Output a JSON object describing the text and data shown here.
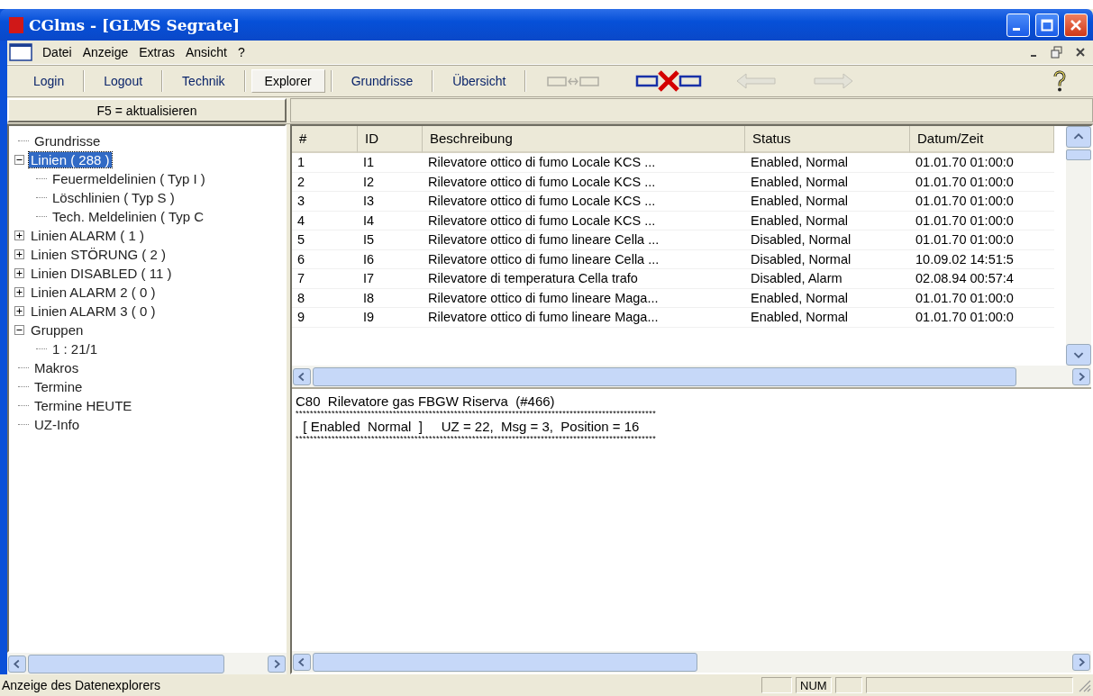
{
  "window": {
    "title": "CGlms - [GLMS Segrate]"
  },
  "menu": [
    "Datei",
    "Anzeige",
    "Extras",
    "Ansicht",
    "?"
  ],
  "toolbar": {
    "buttons": [
      {
        "label": "Login",
        "selected": false
      },
      {
        "label": "Logout",
        "selected": false
      },
      {
        "label": "Technik",
        "selected": false
      },
      {
        "label": "Explorer",
        "selected": true
      },
      {
        "label": "Grundrisse",
        "selected": false
      },
      {
        "label": "Übersicht",
        "selected": false
      }
    ],
    "icons": [
      {
        "kind": "connect",
        "disabled": true
      },
      {
        "kind": "disconnect",
        "disabled": false
      },
      {
        "kind": "back",
        "disabled": true
      },
      {
        "kind": "forward",
        "disabled": true
      },
      {
        "kind": "help",
        "disabled": false
      }
    ]
  },
  "refresh_button": "F5 = aktualisieren",
  "tree": [
    {
      "label": "Grundrisse",
      "selected": false
    },
    {
      "label": "Linien ( 288 )",
      "selected": true,
      "expanded": true,
      "children": [
        {
          "label": "Feuermeldelinien ( Typ I )",
          "selected": false
        },
        {
          "label": "Löschlinien ( Typ S )",
          "selected": false
        },
        {
          "label": "Tech. Meldelinien ( Typ C",
          "selected": false
        }
      ]
    },
    {
      "label": "Linien ALARM ( 1 )",
      "selected": false,
      "expanded": false
    },
    {
      "label": "Linien STÖRUNG ( 2 )",
      "selected": false,
      "expanded": false
    },
    {
      "label": "Linien DISABLED ( 11 )",
      "selected": false,
      "expanded": false
    },
    {
      "label": "Linien ALARM 2 ( 0 )",
      "selected": false,
      "expanded": false
    },
    {
      "label": "Linien ALARM 3 ( 0 )",
      "selected": false,
      "expanded": false
    },
    {
      "label": "Gruppen",
      "selected": false,
      "expanded": true,
      "children": [
        {
          "label": "1 : 21/1",
          "selected": false
        }
      ]
    },
    {
      "label": "Makros",
      "selected": false
    },
    {
      "label": "Termine",
      "selected": false
    },
    {
      "label": "Termine HEUTE",
      "selected": false
    },
    {
      "label": "UZ-Info",
      "selected": false
    }
  ],
  "table": {
    "columns": [
      "#",
      "ID",
      "Beschreibung",
      "Status",
      "Datum/Zeit"
    ],
    "rows": [
      [
        "1",
        "I1",
        "Rilevatore ottico di fumo Locale KCS ...",
        "Enabled, Normal",
        "01.01.70 01:00:0"
      ],
      [
        "2",
        "I2",
        "Rilevatore ottico di fumo Locale KCS ...",
        "Enabled, Normal",
        "01.01.70 01:00:0"
      ],
      [
        "3",
        "I3",
        "Rilevatore ottico di fumo Locale KCS ...",
        "Enabled, Normal",
        "01.01.70 01:00:0"
      ],
      [
        "4",
        "I4",
        "Rilevatore ottico di fumo Locale KCS ...",
        "Enabled, Normal",
        "01.01.70 01:00:0"
      ],
      [
        "5",
        "I5",
        "Rilevatore ottico di fumo lineare Cella ...",
        "Disabled, Normal",
        "01.01.70 01:00:0"
      ],
      [
        "6",
        "I6",
        "Rilevatore ottico di fumo lineare Cella ...",
        "Disabled, Normal",
        "10.09.02 14:51:5"
      ],
      [
        "7",
        "I7",
        "Rilevatore di temperatura Cella trafo",
        "Disabled, Alarm",
        "02.08.94 00:57:4"
      ],
      [
        "8",
        "I8",
        "Rilevatore ottico di fumo lineare Maga...",
        "Enabled, Normal",
        "01.01.70 01:00:0"
      ],
      [
        "9",
        "I9",
        "Rilevatore ottico di fumo lineare Maga...",
        "Enabled, Normal",
        "01.01.70 01:00:0"
      ]
    ]
  },
  "details": [
    "C80  Rilevatore gas FBGW Riserva  (#466)",
    "****************************************************************************************************",
    "  [ Enabled  Normal  ]     UZ = 22,  Msg = 3,  Position = 16",
    "****************************************************************************************************"
  ],
  "status_bar": {
    "text": "Anzeige des Datenexplorers",
    "panels": [
      "NUM"
    ]
  }
}
